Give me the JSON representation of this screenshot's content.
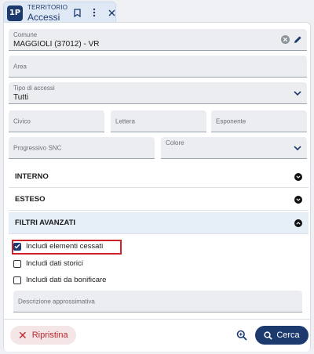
{
  "tab": {
    "logo": "1P",
    "subtitle": "TERRITORIO",
    "title": "Accessi"
  },
  "fields": {
    "comune": {
      "label": "Comune",
      "value": "MAGGIOLI (37012) - VR"
    },
    "area": {
      "placeholder": "Area"
    },
    "tipo": {
      "label": "Tipo di accessi",
      "value": "Tutti"
    },
    "civico": {
      "placeholder": "Civico"
    },
    "lettera": {
      "placeholder": "Lettera"
    },
    "esponente": {
      "placeholder": "Esponente"
    },
    "progressivo": {
      "placeholder": "Progressivo SNC"
    },
    "colore": {
      "placeholder": "Colore"
    }
  },
  "sections": {
    "interno": "INTERNO",
    "esteso": "ESTESO",
    "filtri": "FILTRI AVANZATI"
  },
  "checks": {
    "cessati": {
      "label": "Includi elementi cessati",
      "checked": true
    },
    "storici": {
      "label": "Includi dati storici",
      "checked": false
    },
    "bonificare": {
      "label": "Includi dati da bonificare",
      "checked": false
    }
  },
  "descrizione": {
    "placeholder": "Descrizione approssimativa"
  },
  "footer": {
    "reset_label": "Ripristina",
    "search_label": "Cerca"
  },
  "colors": {
    "primary": "#1d3a6e",
    "danger": "#c0252c",
    "highlight": "#d0202a",
    "active_section": "#e6eef8"
  }
}
